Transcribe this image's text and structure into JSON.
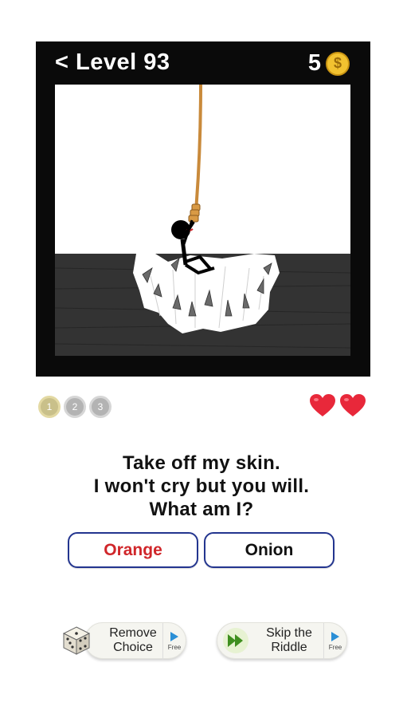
{
  "header": {
    "back_label": "< Level 93",
    "coin_count": "5",
    "coin_symbol": "$"
  },
  "progress": {
    "steps": [
      "1",
      "2",
      "3"
    ],
    "current_step": 1
  },
  "lives": {
    "hearts": 2,
    "heart_color": "#e8283a"
  },
  "question": {
    "lines": [
      "Take off my skin.",
      "I won't cry but you will.",
      "What am I?"
    ]
  },
  "answers": [
    {
      "label": "Orange",
      "color": "#d0262a"
    },
    {
      "label": "Onion",
      "color": "#111111"
    }
  ],
  "helpers": [
    {
      "line1": "Remove",
      "line2": "Choice",
      "tag": "Free",
      "icon": "dice-icon"
    },
    {
      "line1": "Skip the",
      "line2": "Riddle",
      "tag": "Free",
      "icon": "fast-forward-icon"
    }
  ],
  "colors": {
    "frame": "#0a0a0a",
    "button_border": "#23358f",
    "coin": "#f2c230",
    "rope": "#c98a3b",
    "floor": "#333333"
  }
}
